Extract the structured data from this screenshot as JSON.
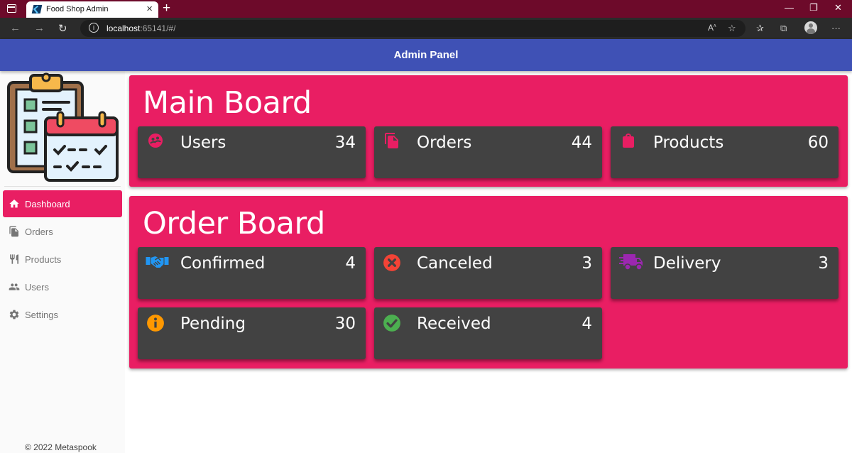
{
  "browser": {
    "tab_title": "Food Shop Admin",
    "url_host": "localhost",
    "url_rest": ":65141/#/"
  },
  "appbar": {
    "title": "Admin Panel"
  },
  "sidebar": {
    "items": [
      {
        "label": "Dashboard",
        "icon": "home-icon",
        "active": true
      },
      {
        "label": "Orders",
        "icon": "document-icon",
        "active": false
      },
      {
        "label": "Products",
        "icon": "fork-knife-icon",
        "active": false
      },
      {
        "label": "Users",
        "icon": "users-icon",
        "active": false
      },
      {
        "label": "Settings",
        "icon": "gear-icon",
        "active": false
      }
    ],
    "footer": "© 2022 Metaspook"
  },
  "main_board": {
    "title": "Main Board",
    "cards": [
      {
        "label": "Users",
        "value": "34",
        "icon": "users-icon",
        "color": "#e91e63"
      },
      {
        "label": "Orders",
        "value": "44",
        "icon": "document-icon",
        "color": "#e91e63"
      },
      {
        "label": "Products",
        "value": "60",
        "icon": "shopping-bag-icon",
        "color": "#e91e63"
      }
    ]
  },
  "order_board": {
    "title": "Order Board",
    "cards": [
      {
        "label": "Confirmed",
        "value": "4",
        "icon": "handshake-icon",
        "color": "#2196f3"
      },
      {
        "label": "Canceled",
        "value": "3",
        "icon": "cancel-icon",
        "color": "#f44336"
      },
      {
        "label": "Delivery",
        "value": "3",
        "icon": "truck-icon",
        "color": "#9c27b0"
      },
      {
        "label": "Pending",
        "value": "30",
        "icon": "info-icon",
        "color": "#ff9800"
      },
      {
        "label": "Received",
        "value": "4",
        "icon": "check-circle-icon",
        "color": "#4caf50"
      }
    ]
  },
  "colors": {
    "appbar": "#3f51b5",
    "accent": "#e91e63",
    "card": "#424242"
  }
}
